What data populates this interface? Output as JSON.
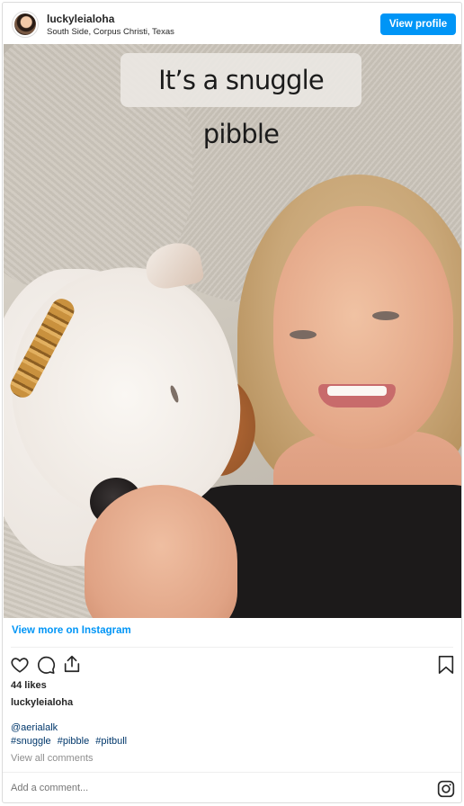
{
  "header": {
    "username": "luckyleialoha",
    "location": "South Side, Corpus Christi, Texas",
    "view_profile_label": "View profile"
  },
  "photo": {
    "caption_overlay": "It’s a snuggle pibble"
  },
  "post": {
    "view_more_label": "View more on Instagram",
    "likes": "44 likes",
    "owner": "luckyleialoha",
    "mention": "@aerialalk",
    "hashtags": [
      "#snuggle",
      "#pibble",
      "#pitbull"
    ],
    "view_comments_label": "View all comments",
    "comment_placeholder": "Add a comment..."
  },
  "icons": {
    "like": "heart-icon",
    "comment": "comment-bubble-icon",
    "share": "share-upload-icon",
    "save": "bookmark-icon",
    "brand": "instagram-icon"
  },
  "colors": {
    "accent": "#0095f6",
    "link": "#00376b",
    "muted": "#8e8e8e"
  }
}
